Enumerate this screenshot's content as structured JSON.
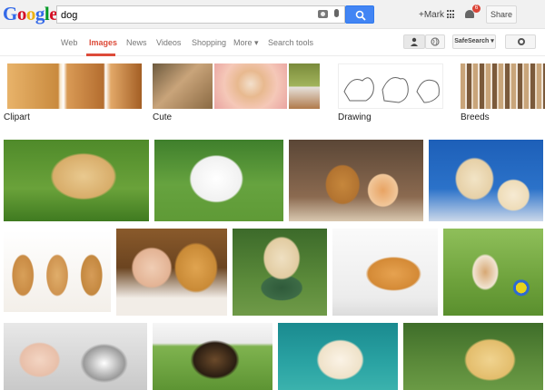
{
  "header": {
    "logo_letters": [
      "G",
      "o",
      "o",
      "g",
      "l",
      "e"
    ],
    "search_query": "dog",
    "plus_mark": "+Mark",
    "notification_count": "6",
    "share_label": "Share"
  },
  "tabs": [
    {
      "label": "Web",
      "active": false
    },
    {
      "label": "Images",
      "active": true
    },
    {
      "label": "News",
      "active": false
    },
    {
      "label": "Videos",
      "active": false
    },
    {
      "label": "Shopping",
      "active": false
    },
    {
      "label": "More ▾",
      "active": false
    },
    {
      "label": "Search tools",
      "active": false
    }
  ],
  "safesearch_label": "SafeSearch ▾",
  "related": [
    {
      "label": "Clipart"
    },
    {
      "label": "Cute"
    },
    {
      "label": "Drawing"
    },
    {
      "label": "Breeds"
    }
  ],
  "colors": {
    "accent_red": "#dd4b39",
    "search_blue": "#4285f4"
  }
}
